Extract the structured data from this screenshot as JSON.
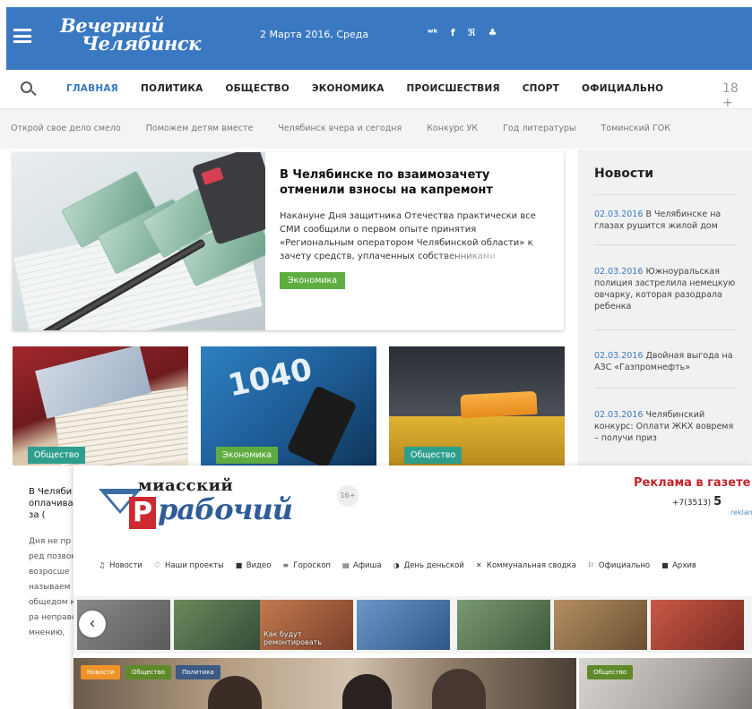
{
  "header": {
    "logo_line1": "Вечерний",
    "logo_line2": "Челябинск",
    "date": "2 Марта 2016, Среда",
    "socials": [
      "vk",
      "f",
      "rss",
      "sitemap"
    ],
    "social_glyphs": [
      "ʷᵏ",
      "f",
      "ℜ",
      "♣"
    ],
    "accent": "#3a78c2"
  },
  "nav": {
    "items": [
      "ГЛАВНАЯ",
      "ПОЛИТИКА",
      "ОБЩЕСТВО",
      "ЭКОНОМИКА",
      "ПРОИСШЕСТВИЯ",
      "СПОРТ",
      "ОФИЦИАЛЬНО"
    ],
    "active_index": 0,
    "age": "18 +"
  },
  "tags": [
    "Открой свое дело смело",
    "Поможем детям вместе",
    "Челябинск вчера и сегодня",
    "Конкурс УК",
    "Год литературы",
    "Томинский ГОК"
  ],
  "featured": {
    "title": "В Челябинске по взаимозачету отменили взносы на капремонт",
    "text": "Накануне Дня защитника Отечества практически все СМИ сообщили о первом опыте принятия «Региональным оператором Челябинской области» к зачету средств, уплаченных собственниками",
    "badge": "Экономика"
  },
  "news": {
    "heading": "Новости",
    "items": [
      {
        "date": "02.03.2016",
        "text": "В Челябинске на глазах рушится жилой дом"
      },
      {
        "date": "02.03.2016",
        "text": "Южноуральская полиция застрелила немецкую овчарку, которая разодрала ребенка"
      },
      {
        "date": "02.03.2016",
        "text": "Двойная выгода на АЗС «Газпромнефть»"
      },
      {
        "date": "02.03.2016",
        "text": "Челябинский конкурс: Оплати ЖКХ вовремя – получи приз"
      }
    ]
  },
  "cards": [
    {
      "badge": "Общество",
      "badge_color": "#2e9f8e"
    },
    {
      "badge": "Экономика",
      "badge_color": "#5fad41",
      "image_text": "1040"
    },
    {
      "badge": "Общество",
      "badge_color": "#2e9f8e"
    }
  ],
  "excerpt": {
    "title": "В Челяби оплачива счета за (",
    "text": "Дня не пр нам в ред позвонил возросше называем общедом крайне ра неправе мнению,"
  },
  "overlay": {
    "logo_top": "миасский",
    "logo_main": "рабочий",
    "logo_letter": "Р",
    "age": "16+",
    "ad_title": "Реклама в газете и",
    "ad_phone_prefix": "+7(3513)",
    "ad_phone_digit": "5",
    "ad_mail": "reklam",
    "menu": [
      {
        "icon": "bell-icon",
        "glyph": "♫",
        "label": "Новости"
      },
      {
        "icon": "heart-icon",
        "glyph": "♡",
        "label": "Наши проекты"
      },
      {
        "icon": "video-icon",
        "glyph": "■",
        "label": "Видео"
      },
      {
        "icon": "horoscope-icon",
        "glyph": "≡",
        "label": "Гороскоп"
      },
      {
        "icon": "poster-icon",
        "glyph": "▤",
        "label": "Афиша"
      },
      {
        "icon": "money-icon",
        "glyph": "◑",
        "label": "День деньской"
      },
      {
        "icon": "shuffle-icon",
        "glyph": "✕",
        "label": "Коммунальная сводка"
      },
      {
        "icon": "flag-icon",
        "glyph": "⚐",
        "label": "Официально"
      },
      {
        "icon": "archive-icon",
        "glyph": "■",
        "label": "Архив"
      }
    ],
    "thumbs": [
      {
        "caption": "",
        "color": "#7a7a7a"
      },
      {
        "caption": "",
        "color": "#3f5e46"
      },
      {
        "caption": "Как будут ремонтировать",
        "color": "#9d5a3c"
      },
      {
        "caption": "",
        "color": "#4d77a8"
      },
      {
        "caption": "",
        "color": "#4f6a4c"
      },
      {
        "caption": "",
        "color": "#8a6a4a"
      },
      {
        "caption": "",
        "color": "#a83a2c"
      }
    ],
    "pills": [
      {
        "label": "Новости",
        "color": "#f0942a"
      },
      {
        "label": "Общество",
        "color": "#5f8a2a"
      },
      {
        "label": "Политика",
        "color": "#3b5b86"
      },
      {
        "label": "Общество",
        "color": "#5f8a2a"
      }
    ]
  }
}
